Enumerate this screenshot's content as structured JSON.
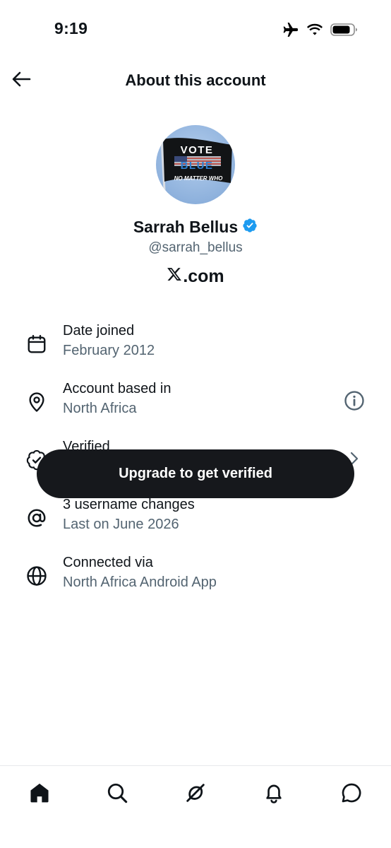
{
  "status_bar": {
    "time": "9:19",
    "icons": [
      "airplane-icon",
      "wifi-icon",
      "battery-icon"
    ]
  },
  "header": {
    "title": "About this account",
    "back_icon": "arrow-left-icon"
  },
  "profile": {
    "avatar_text": {
      "line1": "VOTE",
      "line2": "BLUE",
      "line3": "NO MATTER WHO"
    },
    "display_name": "Sarrah Bellus",
    "verified_badge_icon": "verified-badge-icon",
    "handle": "@sarrah_bellus",
    "platform": ".com"
  },
  "details": [
    {
      "icon": "calendar-icon",
      "title": "Date joined",
      "value": "February 2012"
    },
    {
      "icon": "location-pin-icon",
      "title": "Account based in",
      "value": "North Africa",
      "action_icon": "info-icon"
    },
    {
      "icon": "verified-outline-icon",
      "title": "Verified",
      "value": "",
      "action_icon": "chevron-right-icon"
    },
    {
      "icon": "at-sign-icon",
      "title": "3 username changes",
      "value": "Last on June 2026"
    },
    {
      "icon": "globe-icon",
      "title": "Connected via",
      "value": "North Africa Android App"
    }
  ],
  "toast": {
    "label": "Upgrade to get verified"
  },
  "tab_bar": {
    "tabs": [
      {
        "name": "home",
        "icon": "home-icon",
        "active": true
      },
      {
        "name": "search",
        "icon": "search-icon",
        "active": false
      },
      {
        "name": "grok",
        "icon": "grok-icon",
        "active": false
      },
      {
        "name": "notifications",
        "icon": "bell-icon",
        "active": false
      },
      {
        "name": "messages",
        "icon": "message-icon",
        "active": false
      }
    ]
  },
  "colors": {
    "text_primary": "#0f1419",
    "text_secondary": "#536471",
    "verified_blue": "#1d9bf0",
    "toast_background": "#16181c"
  }
}
